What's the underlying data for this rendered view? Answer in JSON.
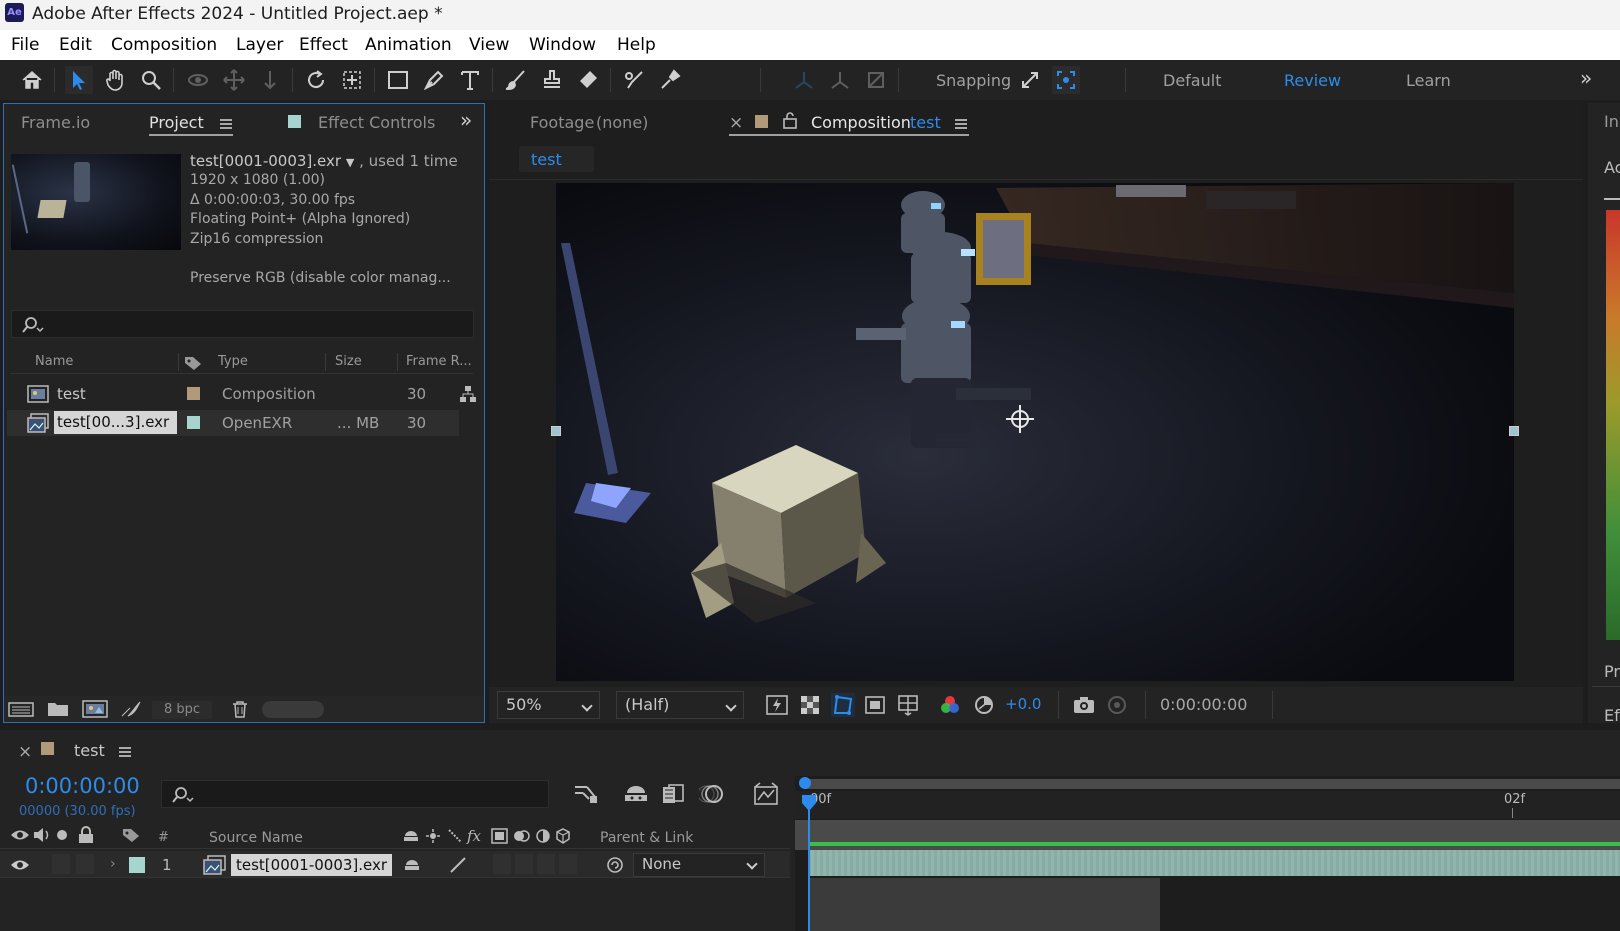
{
  "app": {
    "title": "Adobe After Effects 2024 - Untitled Project.aep *",
    "logo": "Ae"
  },
  "menu": [
    "File",
    "Edit",
    "Composition",
    "Layer",
    "Effect",
    "Animation",
    "View",
    "Window",
    "Help"
  ],
  "toolbar": {
    "snapping_label": "Snapping",
    "workspaces": [
      "Default",
      "Review",
      "Learn"
    ],
    "active_workspace": "Review"
  },
  "project_panel": {
    "tabs": [
      "Frame.io",
      "Project",
      "Effect Controls"
    ],
    "active_tab": "Project",
    "selected_item": {
      "name": "test[0001-0003].exr",
      "usage": ", used 1 time",
      "dimensions": "1920 x 1080 (1.00)",
      "duration": "Δ 0:00:00:03, 30.00 fps",
      "depth": "Floating Point+ (Alpha Ignored)",
      "compression": "Zip16 compression",
      "color": "Preserve RGB (disable color manag..."
    },
    "search_placeholder": "",
    "columns": [
      "Name",
      "Type",
      "Size",
      "Frame R..."
    ],
    "items": [
      {
        "name": "test",
        "label_color": "#b09a7a",
        "type": "Composition",
        "size": "",
        "frame_rate": "30"
      },
      {
        "name": "test[00...3].exr",
        "label_color": "#a6d4cf",
        "type": "OpenEXR",
        "size": "... MB",
        "frame_rate": "30"
      }
    ],
    "bpc": "8 bpc"
  },
  "viewer": {
    "footage_tab": "Footage",
    "footage_value": "(none)",
    "comp_tab": "Composition",
    "comp_name": "test",
    "breadcrumb": "test",
    "zoom": "50%",
    "resolution": "(Half)",
    "exposure": "+0.0",
    "timecode": "0:00:00:00"
  },
  "right_panel": {
    "labels": [
      "In",
      "Ac",
      "Pr",
      "Ef"
    ]
  },
  "timeline": {
    "tab_name": "test",
    "timecode": "0:00:00:00",
    "frame_info": "00000 (30.00 fps)",
    "ruler": [
      "00f",
      "02f"
    ],
    "columns": {
      "number": "#",
      "source_name": "Source Name",
      "parent": "Parent & Link"
    },
    "layers": [
      {
        "index": "1",
        "name": "test[0001-0003].exr",
        "parent": "None",
        "label_color": "#a6d4cf"
      }
    ]
  },
  "colors": {
    "accent_blue": "#2d8ceb",
    "panel_bg": "#232323",
    "timeline_track": "#8fb5ad"
  }
}
